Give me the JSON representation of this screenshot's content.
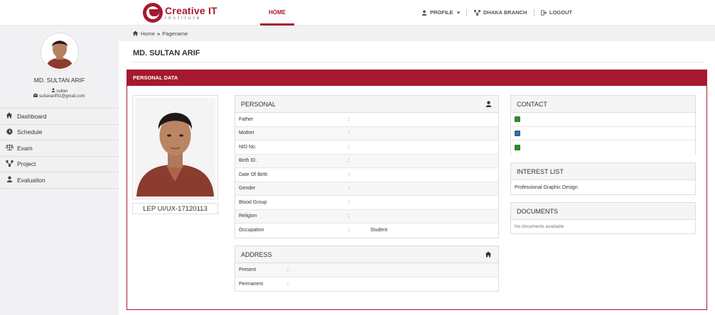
{
  "header": {
    "logo_title": "Creative IT",
    "logo_subtitle": "Institute",
    "nav": {
      "home": "HOME",
      "profile": "PROFILE",
      "branch": "DHAKA BRANCH",
      "logout": "LOGOUT"
    }
  },
  "sidebar": {
    "name": "MD. SULTAN ARIF",
    "username": "sultan",
    "email": "sultanarif91@gmail.com",
    "menu": [
      {
        "label": "Dashboard",
        "icon": "dashboard-icon"
      },
      {
        "label": "Schedule",
        "icon": "clock-icon"
      },
      {
        "label": "Exam",
        "icon": "balance-scale-icon"
      },
      {
        "label": "Project",
        "icon": "sitemap-icon"
      },
      {
        "label": "Evaluation",
        "icon": "user-icon"
      }
    ]
  },
  "breadcrumb": {
    "home": "Home",
    "current": "Pagename"
  },
  "page_title": "MD. SULTAN ARIF",
  "panel_title": "PERSONAL DATA",
  "photo_caption": "LEP UI/UX-17120113",
  "personal": {
    "title": "PERSONAL",
    "rows": [
      {
        "label": "Father",
        "value": ""
      },
      {
        "label": "Mother",
        "value": ""
      },
      {
        "label": "NID No.",
        "value": ""
      },
      {
        "label": "Birth ID.",
        "value": ""
      },
      {
        "label": "Date Of Birth",
        "value": ""
      },
      {
        "label": "Gender",
        "value": ""
      },
      {
        "label": "Blood Group",
        "value": ""
      },
      {
        "label": "Religion",
        "value": ""
      },
      {
        "label": "Occupation",
        "value": "Student"
      }
    ]
  },
  "address": {
    "title": "ADDRESS",
    "rows": [
      {
        "label": "Present",
        "value": ""
      },
      {
        "label": "Permanent",
        "value": ""
      }
    ]
  },
  "contact": {
    "title": "CONTACT",
    "icons": [
      "phone-icon",
      "email-icon",
      "check-icon"
    ]
  },
  "interest": {
    "title": "INTEREST LIST",
    "item": "Professional Graphic Design"
  },
  "documents": {
    "title": "DOCUMENTS",
    "empty_text": "No documents available"
  },
  "colors": {
    "brand": "#a6192e",
    "sidebar_bg": "#f1f1f3"
  }
}
